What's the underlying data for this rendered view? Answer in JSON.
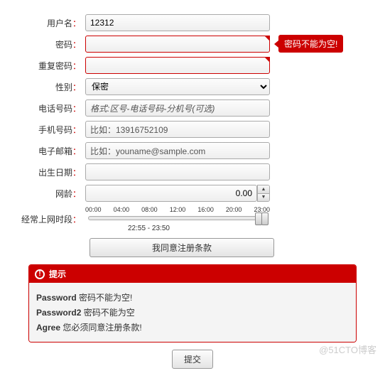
{
  "fields": {
    "username": {
      "label": "用户名",
      "value": "12312"
    },
    "password": {
      "label": "密码",
      "value": "",
      "tooltip": "密码不能为空!"
    },
    "password2": {
      "label": "重复密码",
      "value": ""
    },
    "gender": {
      "label": "性别",
      "value": "保密"
    },
    "phone": {
      "label": "电话号码",
      "placeholder": "格式:区号-电话号码-分机号(可选)"
    },
    "mobile": {
      "label": "手机号码",
      "placeholder": "比如：13916752109"
    },
    "email": {
      "label": "电子邮箱",
      "placeholder": "比如：youname@sample.com"
    },
    "birthday": {
      "label": "出生日期",
      "value": ""
    },
    "netage": {
      "label": "网龄",
      "value": "0.00"
    },
    "timerange": {
      "label": "经常上网时段",
      "ticks": [
        "00:00",
        "04:00",
        "08:00",
        "12:00",
        "16:00",
        "20:00",
        "23:00"
      ],
      "caption": "22:55 - 23:50",
      "startPct": 95.5,
      "endPct": 99.3
    }
  },
  "buttons": {
    "agree": "我同意注册条款",
    "submit": "提交"
  },
  "alert": {
    "title": "提示",
    "items": [
      {
        "key": "Password",
        "msg": "密码不能为空!"
      },
      {
        "key": "Password2",
        "msg": "密码不能为空"
      },
      {
        "key": "Agree",
        "msg": "您必须同意注册条款!"
      }
    ]
  },
  "watermark": "@51CTO博客"
}
